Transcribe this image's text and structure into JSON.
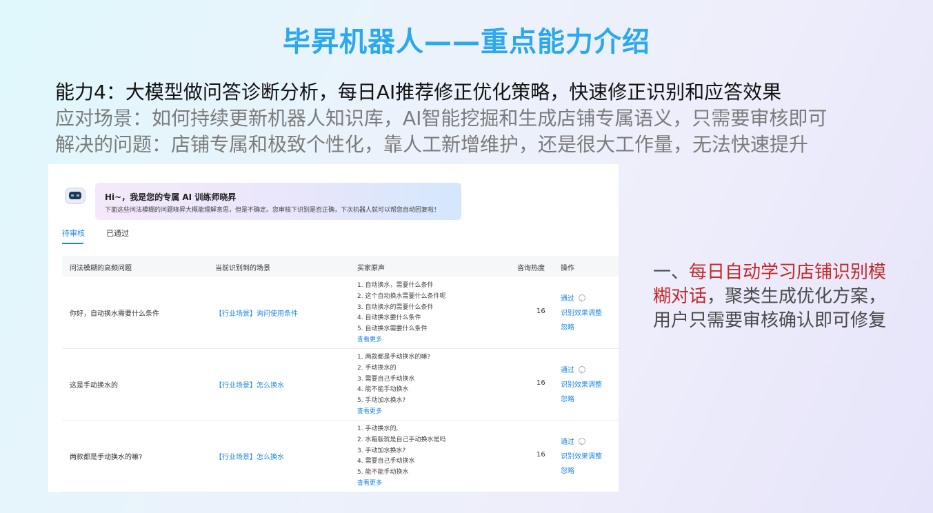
{
  "slide": {
    "title": "毕昇机器人——重点能力介绍",
    "line1": "能力4：大模型做问答诊断分析，每日AI推荐修正优化策略，快速修正识别和应答效果",
    "line2": "应对场景：如何持续更新机器人知识库，AI智能挖掘和生成店铺专属语义，只需要审核即可",
    "line3": "解决的问题：店铺专属和极致个性化，靠人工新增维护，还是很大工作量，无法快速提升"
  },
  "banner": {
    "title": "Hi~，我是您的专属 AI 训练师晓昇",
    "subtitle": "下面这些问法模糊的问题晓昇大概能理解意思，但是不确定。您审核下识别是否正确，下次机器人就可以帮您自动回复啦！"
  },
  "tabs": [
    "待审核",
    "已通过"
  ],
  "table": {
    "headers": [
      "问法模糊的高频问题",
      "当前识别到的场景",
      "买家原声",
      "咨询热度",
      "操作"
    ],
    "rows": [
      {
        "question": "你好，自动换水需要什么条件",
        "scene": "【行业场景】询问使用条件",
        "voices": [
          "1. 自动换水，需要什么条件",
          "2. 这个自动换水需要什么条件呢",
          "3. 自动换水的需要什么条件",
          "4. 自动换水要什么条件",
          "5. 自动换水需要什么条件"
        ],
        "more": "查看更多",
        "heat": "16",
        "ops": [
          "通过",
          "识别效果调整",
          "忽略"
        ]
      },
      {
        "question": "这是手动换水的",
        "scene": "【行业场景】怎么换水",
        "voices": [
          "1. 两款都是手动换水的嘛?",
          "2. 手动换水的",
          "3. 需要自己手动换水",
          "4. 能不能手动换水",
          "5. 手动加水换水?"
        ],
        "more": "查看更多",
        "heat": "16",
        "ops": [
          "通过",
          "识别效果调整",
          "忽略"
        ]
      },
      {
        "question": "两款都是手动换水的嘛?",
        "scene": "【行业场景】怎么换水",
        "voices": [
          "1. 手动换水的,",
          "2. 水箱版就是自己手动换水是吗",
          "3. 手动加水换水?",
          "4. 需要自己手动换水",
          "5. 能不能手动换水"
        ],
        "more": "查看更多",
        "heat": "16",
        "ops": [
          "通过",
          "识别效果调整",
          "忽略"
        ]
      }
    ]
  },
  "side": {
    "prefix": "一、",
    "highlight": "每日自动学习店铺识别模糊对话",
    "rest": "，聚类生成优化方案，用户只需要审核确认即可修复"
  },
  "colors": {
    "title": "#2ba8ee",
    "link": "#1e88e5",
    "highlight": "#c62828"
  }
}
